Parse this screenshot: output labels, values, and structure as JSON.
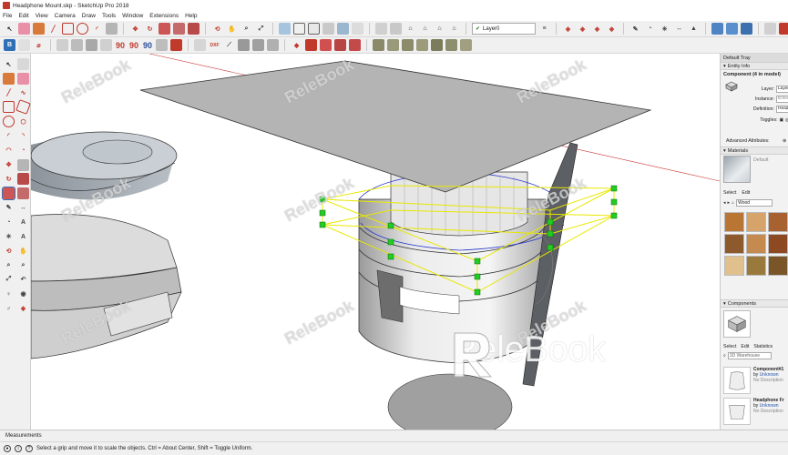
{
  "window": {
    "title": "Headphone Mount.skp - SketchUp Pro 2018"
  },
  "menu": [
    "File",
    "Edit",
    "View",
    "Camera",
    "Draw",
    "Tools",
    "Window",
    "Extensions",
    "Help"
  ],
  "toolbar": {
    "layer_value": "Layer0",
    "angle_label": "90"
  },
  "tray": {
    "title": "Default Tray",
    "entity_info": {
      "header": "Entity Info",
      "title": "Component (4 in model)",
      "layer_label": "Layer:",
      "layer_value": "Layer0",
      "instance_label": "Instance:",
      "instance_value": "Enter",
      "definition_label": "Definition:",
      "definition_value": "Headphone",
      "toggles_label": "Toggles:",
      "advanced": "Advanced Attributes:"
    },
    "materials": {
      "header": "Materials",
      "current": "Default",
      "select_tab": "Select",
      "edit_tab": "Edit",
      "library": "Wood",
      "swatch_colors": [
        "#b87533",
        "#d6a36a",
        "#a86130",
        "#8c5a2c",
        "#c48a4f",
        "#8d4a22",
        "#e0c08c",
        "#9a7a3c",
        "#7a5528"
      ]
    },
    "components": {
      "header": "Components",
      "select_tab": "Select",
      "edit_tab": "Edit",
      "stats_tab": "Statistics",
      "search_value": "3D Warehouse",
      "items": [
        {
          "name": "Component#1",
          "by": "by",
          "author": "Unknown",
          "desc": "No Description"
        },
        {
          "name": "Headphone Fr",
          "by": "by",
          "author": "Unknown",
          "desc": "No Description"
        }
      ]
    }
  },
  "measurements_label": "Measurements",
  "status_text": "Select a grip and move it to scale the objects. Ctrl = About Center, Shift = Toggle Uniform.",
  "watermark": {
    "brand": "ReleBook"
  },
  "colors": {
    "selection": "#f0f000",
    "grip": "#22cc22",
    "axis_red": "#cc3333",
    "edge_blue": "#2233cc"
  }
}
